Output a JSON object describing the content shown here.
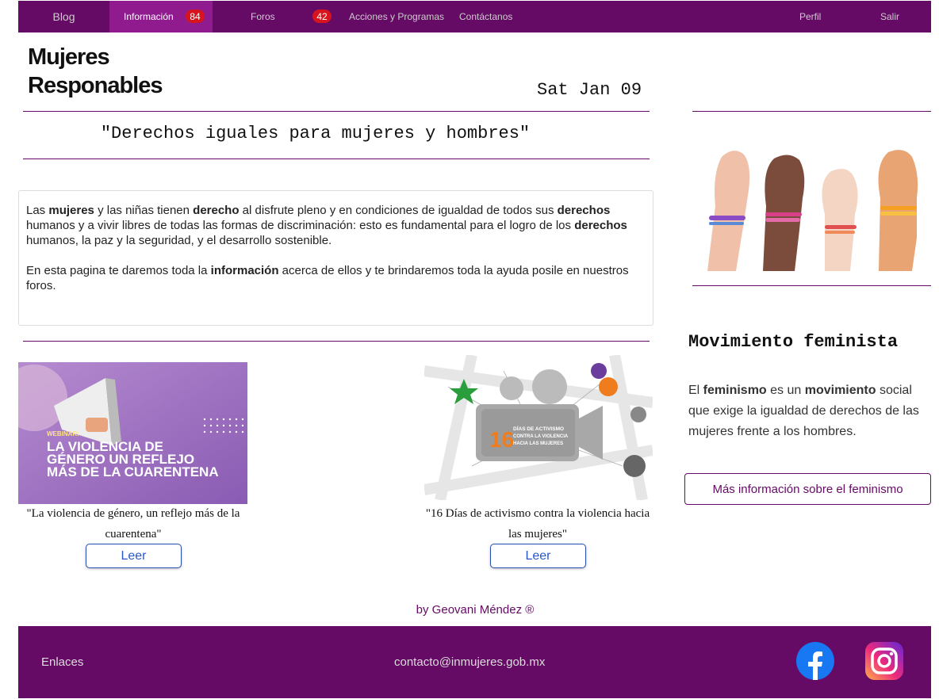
{
  "nav": {
    "blog": "Blog",
    "informacion": "Información",
    "informacion_badge": "84",
    "foros": "Foros",
    "foros_badge": "42",
    "acciones": "Acciones y Programas",
    "contacto": "Contáctanos",
    "perfil": "Perfil",
    "salir": "Salir"
  },
  "header": {
    "title": "Mujeres Responables",
    "date": "Sat Jan 09",
    "slogan": "\"Derechos iguales para mujeres y hombres\""
  },
  "intro": {
    "p1_a": "Las ",
    "p1_b": "mujeres",
    "p1_c": " y las niñas tienen ",
    "p1_d": "derecho",
    "p1_e": " al disfrute pleno y en condiciones de igualdad de todos sus ",
    "p1_f": "derechos",
    "p1_g": " humanos y a vivir libres de todas las formas de discriminación: esto es fundamental para el logro de los ",
    "p1_h": "derechos",
    "p1_i": " humanos, la paz y la seguridad, y el desarrollo sostenible.",
    "p2_a": "En esta pagina te daremos toda la ",
    "p2_b": "información",
    "p2_c": " acerca de ellos y te brindaremos toda la ayuda posile en nuestros foros."
  },
  "cards": [
    {
      "img_tag": "WEBINAR:",
      "img_title_1": "LA VIOLENCIA DE",
      "img_title_2": "GÉNERO UN REFLEJO",
      "img_title_3": "MÁS DE LA CUARENTENA",
      "caption": "\"La violencia de género, un reflejo más de la cuarentena\"",
      "button": "Leer"
    },
    {
      "img_num": "16",
      "img_line_1": "DÍAS DE ACTIVISMO",
      "img_line_2": "CONTRA LA VIOLENCIA",
      "img_line_3": "HACIA LAS MUJERES",
      "caption": "\"16 Días de activismo contra la violencia hacia las mujeres\"",
      "button": "Leer"
    }
  ],
  "side": {
    "title": "Movimiento feminista",
    "t_a": "El ",
    "t_b": "feminismo",
    "t_c": " es un ",
    "t_d": "movimiento",
    "t_e": " social que exige la igualdad de derechos de las mujeres frente a los hombres.",
    "button": "Más información sobre el feminismo"
  },
  "byline": "by Geovani Méndez ®",
  "footer": {
    "links": "Enlaces",
    "email": "contacto@inmujeres.gob.mx"
  },
  "colors": {
    "brand": "#650a65",
    "badge": "#d7141d",
    "link_blue": "#2a58c8"
  }
}
